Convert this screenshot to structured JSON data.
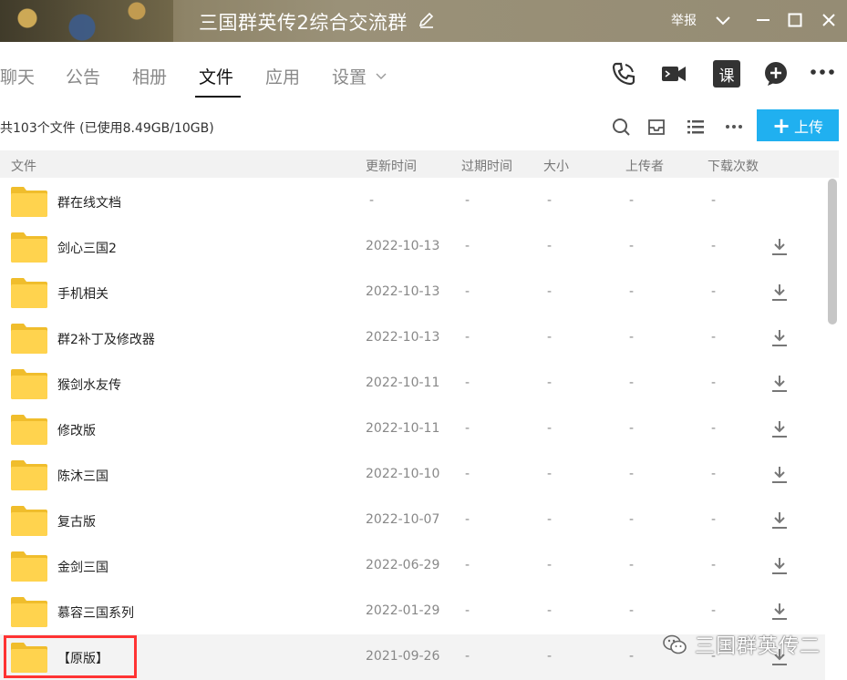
{
  "window": {
    "title": "三国群英传2综合交流群",
    "report_label": "举报"
  },
  "tabs": [
    {
      "label": "聊天"
    },
    {
      "label": "公告"
    },
    {
      "label": "相册"
    },
    {
      "label": "文件",
      "active": true
    },
    {
      "label": "应用"
    },
    {
      "label": "设置"
    }
  ],
  "top_icons": [
    "phone-icon",
    "video-icon",
    "course-icon",
    "add-icon",
    "more-icon"
  ],
  "course_icon_label": "课",
  "summary": "共103个文件 (已使用8.49GB/10GB)",
  "toolbar_icons": [
    "search-icon",
    "inbox-icon",
    "list-view-icon",
    "more-icon"
  ],
  "upload_label": "上传",
  "columns": {
    "file": "文件",
    "updated": "更新时间",
    "expires": "过期时间",
    "size": "大小",
    "uploader": "上传者",
    "downloads": "下载次数"
  },
  "rows": [
    {
      "name": "群在线文档",
      "updated": "-",
      "expires": "-",
      "size": "-",
      "uploader": "-",
      "downloads": "-"
    },
    {
      "name": "剑心三国2",
      "updated": "2022-10-13",
      "expires": "-",
      "size": "-",
      "uploader": "-",
      "downloads": "-"
    },
    {
      "name": "手机相关",
      "updated": "2022-10-13",
      "expires": "-",
      "size": "-",
      "uploader": "-",
      "downloads": "-"
    },
    {
      "name": "群2补丁及修改器",
      "updated": "2022-10-13",
      "expires": "-",
      "size": "-",
      "uploader": "-",
      "downloads": "-"
    },
    {
      "name": "猴剑水友传",
      "updated": "2022-10-11",
      "expires": "-",
      "size": "-",
      "uploader": "-",
      "downloads": "-"
    },
    {
      "name": "修改版",
      "updated": "2022-10-11",
      "expires": "-",
      "size": "-",
      "uploader": "-",
      "downloads": "-"
    },
    {
      "name": "陈沐三国",
      "updated": "2022-10-10",
      "expires": "-",
      "size": "-",
      "uploader": "-",
      "downloads": "-"
    },
    {
      "name": "复古版",
      "updated": "2022-10-07",
      "expires": "-",
      "size": "-",
      "uploader": "-",
      "downloads": "-"
    },
    {
      "name": "金剑三国",
      "updated": "2022-06-29",
      "expires": "-",
      "size": "-",
      "uploader": "-",
      "downloads": "-"
    },
    {
      "name": "慕容三国系列",
      "updated": "2022-01-29",
      "expires": "-",
      "size": "-",
      "uploader": "-",
      "downloads": "-"
    },
    {
      "name": "【原版】",
      "updated": "2021-09-26",
      "expires": "-",
      "size": "-",
      "uploader": "-",
      "downloads": "-"
    }
  ],
  "watermark": "三国群英传二",
  "colors": {
    "accent": "#20b0f0",
    "folder": "#ffd34e",
    "highlight": "#ff3333"
  }
}
